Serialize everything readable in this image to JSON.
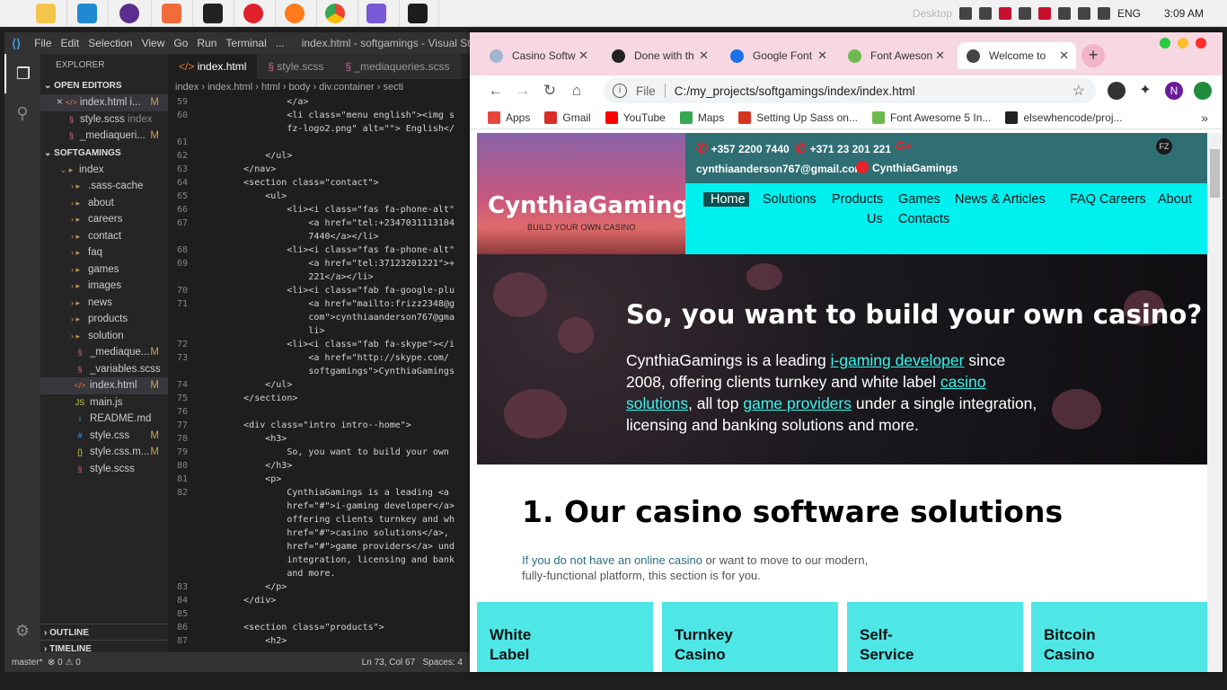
{
  "taskbar": {
    "desktop_label": "Desktop",
    "lang": "ENG",
    "time": "3:09 AM"
  },
  "vscode": {
    "menu": [
      "File",
      "Edit",
      "Selection",
      "View",
      "Go",
      "Run",
      "Terminal",
      "..."
    ],
    "window_title": "index.html - softgamings - Visual Studio Code",
    "explorer_label": "EXPLORER",
    "open_editors_label": "OPEN EDITORS",
    "open_editors": [
      {
        "name": "index.html i...",
        "mod": "M",
        "close": "×"
      },
      {
        "name": "style.scss",
        "extra": "index"
      },
      {
        "name": "_mediaqueri...",
        "mod": "M"
      }
    ],
    "project_label": "SOFTGAMINGS",
    "tree": [
      {
        "name": "index",
        "type": "folder-open"
      },
      {
        "name": ".sass-cache",
        "type": "folder"
      },
      {
        "name": "about",
        "type": "folder"
      },
      {
        "name": "careers",
        "type": "folder"
      },
      {
        "name": "contact",
        "type": "folder"
      },
      {
        "name": "faq",
        "type": "folder"
      },
      {
        "name": "games",
        "type": "folder"
      },
      {
        "name": "images",
        "type": "folder"
      },
      {
        "name": "news",
        "type": "folder"
      },
      {
        "name": "products",
        "type": "folder"
      },
      {
        "name": "solution",
        "type": "folder"
      },
      {
        "name": "_mediaque...",
        "type": "scss",
        "mod": "M"
      },
      {
        "name": "_variables.scss",
        "type": "scss"
      },
      {
        "name": "index.html",
        "type": "html",
        "mod": "M"
      },
      {
        "name": "main.js",
        "type": "js"
      },
      {
        "name": "README.md",
        "type": "md"
      },
      {
        "name": "style.css",
        "type": "css",
        "mod": "M"
      },
      {
        "name": "style.css.m...",
        "type": "json",
        "mod": "M"
      },
      {
        "name": "style.scss",
        "type": "scss"
      }
    ],
    "outline_label": "OUTLINE",
    "timeline_label": "TIMELINE",
    "tabs": [
      "index.html",
      "style.scss",
      "_mediaqueries.scss"
    ],
    "breadcrumb": "index › index.html › html › body › div.container › secti",
    "code_lines": [
      {
        "n": "59",
        "t": "                </a>"
      },
      {
        "n": "60",
        "t": "                <li class=\"menu english\"><img s"
      },
      {
        "n": "",
        "t": "                fz-logo2.png\" alt=\"\"> English</"
      },
      {
        "n": "61",
        "t": ""
      },
      {
        "n": "62",
        "t": "            </ul>"
      },
      {
        "n": "63",
        "t": "        </nav>"
      },
      {
        "n": "64",
        "t": "        <section class=\"contact\">"
      },
      {
        "n": "65",
        "t": "            <ul>"
      },
      {
        "n": "66",
        "t": "                <li><i class=\"fas fa-phone-alt\""
      },
      {
        "n": "67",
        "t": "                    <a href=\"tel:+2347031113104"
      },
      {
        "n": "",
        "t": "                    7440</a></li>"
      },
      {
        "n": "68",
        "t": "                <li><i class=\"fas fa-phone-alt\""
      },
      {
        "n": "69",
        "t": "                    <a href=\"tel:37123201221\">+"
      },
      {
        "n": "",
        "t": "                    221</a></li>"
      },
      {
        "n": "70",
        "t": "                <li><i class=\"fab fa-google-plu"
      },
      {
        "n": "71",
        "t": "                    <a href=\"mailto:frizz2348@g"
      },
      {
        "n": "",
        "t": "                    com\">cynthiaanderson767@gma"
      },
      {
        "n": "",
        "t": "                    li>"
      },
      {
        "n": "72",
        "t": "                <li><i class=\"fab fa-skype\"></i"
      },
      {
        "n": "73",
        "t": "                    <a href=\"http://skype.com/"
      },
      {
        "n": "",
        "t": "                    softgamings\">CynthiaGamings"
      },
      {
        "n": "74",
        "t": "            </ul>"
      },
      {
        "n": "75",
        "t": "        </section>"
      },
      {
        "n": "76",
        "t": ""
      },
      {
        "n": "77",
        "t": "        <div class=\"intro intro--home\">"
      },
      {
        "n": "78",
        "t": "            <h3>"
      },
      {
        "n": "79",
        "t": "                So, you want to build your own"
      },
      {
        "n": "80",
        "t": "            </h3>"
      },
      {
        "n": "81",
        "t": "            <p>"
      },
      {
        "n": "82",
        "t": "                CynthiaGamings is a leading <a"
      },
      {
        "n": "",
        "t": "                href=\"#\">i-gaming developer</a>"
      },
      {
        "n": "",
        "t": "                offering clients turnkey and wh"
      },
      {
        "n": "",
        "t": "                href=\"#\">casino solutions</a>,"
      },
      {
        "n": "",
        "t": "                href=\"#\">game providers</a> und"
      },
      {
        "n": "",
        "t": "                integration, licensing and bank"
      },
      {
        "n": "",
        "t": "                and more."
      },
      {
        "n": "83",
        "t": "            </p>"
      },
      {
        "n": "84",
        "t": "        </div>"
      },
      {
        "n": "85",
        "t": ""
      },
      {
        "n": "86",
        "t": "        <section class=\"products\">"
      },
      {
        "n": "87",
        "t": "            <h2>"
      }
    ],
    "status": {
      "branch": "master*",
      "errors": "⊗ 0 ⚠ 0",
      "position": "Ln 73, Col 67",
      "spaces": "Spaces: 4"
    }
  },
  "chrome": {
    "tabs": [
      {
        "title": "Casino Softw",
        "color": "#9fb6cf"
      },
      {
        "title": "Done with th",
        "color": "#222222"
      },
      {
        "title": "Google Font",
        "color": "#1a73e8"
      },
      {
        "title": "Font Aweson",
        "color": "#6dbb4d"
      },
      {
        "title": "Welcome to",
        "color": "#444444"
      }
    ],
    "file_label": "File",
    "url": "C:/my_projects/softgamings/index/index.html",
    "profile_initial": "N",
    "bookmarks": [
      {
        "label": "Apps",
        "color": "#e8453c"
      },
      {
        "label": "Gmail",
        "color": "#d93025"
      },
      {
        "label": "YouTube",
        "color": "#ff0000"
      },
      {
        "label": "Maps",
        "color": "#34a853"
      },
      {
        "label": "Setting Up Sass on...",
        "color": "#d9341f"
      },
      {
        "label": "Font Awesome 5 In...",
        "color": "#6dbb4d"
      },
      {
        "label": "elsewhencode/proj...",
        "color": "#222222"
      }
    ]
  },
  "site": {
    "logo_title": "CynthiaGamings",
    "logo_sub": "BUILD YOUR OWN CASINO",
    "phone1": "+357 2200 7440",
    "phone2": "+371 23 201 221",
    "email": "cynthiaanderson767@gmail.com",
    "skype": "CynthiaGamings",
    "nav": [
      "Home",
      "Solutions",
      "Products",
      "Games",
      "News & Articles",
      "FAQ",
      "Careers",
      "About",
      "Us",
      "Contacts"
    ],
    "hero_title": "So, you want to build your own casino?",
    "hero": {
      "p1": "CynthiaGamings is a leading ",
      "link1": "i-gaming developer",
      "p2": " since 2008, offering clients turnkey and white label ",
      "link2": "casino solutions",
      "p3": ", all top ",
      "link3": "game providers",
      "p4": " under a single integration, licensing and banking solutions and more."
    },
    "solutions_title": "1. Our casino software solutions",
    "solutions_text": {
      "link": "If you do not have an online casino",
      "rest": " or want to move to our modern, fully-functional platform, this section is for you."
    },
    "cards": [
      "White\nLabel",
      "Turnkey\nCasino",
      "Self-\nService",
      "Bitcoin\nCasino"
    ]
  }
}
